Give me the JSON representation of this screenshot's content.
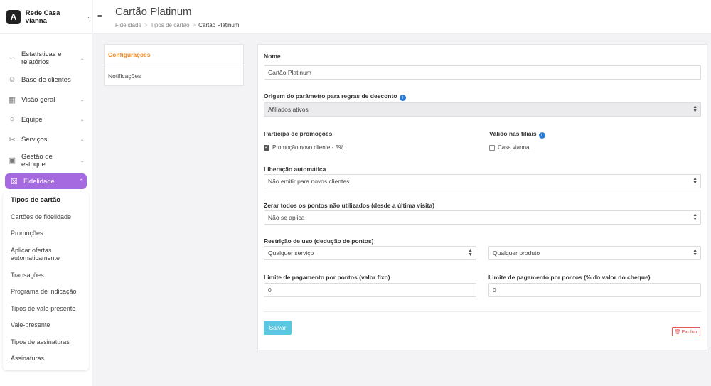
{
  "brand": {
    "name": "Rede Casa vianna",
    "logo_letter": "A"
  },
  "sidebar": {
    "items": [
      {
        "label": "Estatísticas e relatórios",
        "icon": "chart-icon"
      },
      {
        "label": "Base de clientes",
        "icon": "users-icon"
      },
      {
        "label": "Visão geral",
        "icon": "grid-icon"
      },
      {
        "label": "Equipe",
        "icon": "person-icon"
      },
      {
        "label": "Serviços",
        "icon": "scissors-icon"
      },
      {
        "label": "Gestão de estoque",
        "icon": "boxes-icon"
      },
      {
        "label": "Fidelidade",
        "icon": "percent-icon"
      }
    ],
    "submenu": [
      "Tipos de cartão",
      "Cartões de fidelidade",
      "Promoções",
      "Aplicar ofertas automaticamente",
      "Transações",
      "Programa de indicação",
      "Tipos de vale-presente",
      "Vale-presente",
      "Tipos de assinaturas",
      "Assinaturas"
    ]
  },
  "header": {
    "title": "Cartão Platinum",
    "breadcrumb": [
      "Fidelidade",
      "Tipos de cartão",
      "Cartão Platinum"
    ],
    "separator": ">"
  },
  "settings_menu": [
    "Configurações",
    "Notificações"
  ],
  "form": {
    "name_label": "Nome",
    "name_value": "Cartão Platinum",
    "origin_label": "Origem do parâmetro para regras de desconto",
    "origin_value": "Afiliados ativos",
    "promo_label": "Participa de promoções",
    "promo_option": "Promoção novo cliente - 5%",
    "branches_label": "Válido nas filiais",
    "branches_option": "Casa vianna",
    "release_label": "Liberação automática",
    "release_value": "Não emitir para novos clientes",
    "reset_label": "Zerar todos os pontos não utilizados (desde a última visita)",
    "reset_value": "Não se aplica",
    "restriction_label": "Restrição de uso (dedução de pontos)",
    "restriction_service": "Qualquer serviço",
    "restriction_product": "Qualquer produto",
    "limit_fixed_label": "Limite de pagamento por pontos (valor fixo)",
    "limit_fixed_value": "0",
    "limit_pct_label": "Limite de pagamento por pontos (% do valor do cheque)",
    "limit_pct_value": "0",
    "save_label": "Salvar",
    "delete_label": "Excluir"
  },
  "colors": {
    "accent": "#a569e0",
    "orange": "#f08a24",
    "save": "#5cc7e0",
    "danger": "#e05a5a"
  }
}
